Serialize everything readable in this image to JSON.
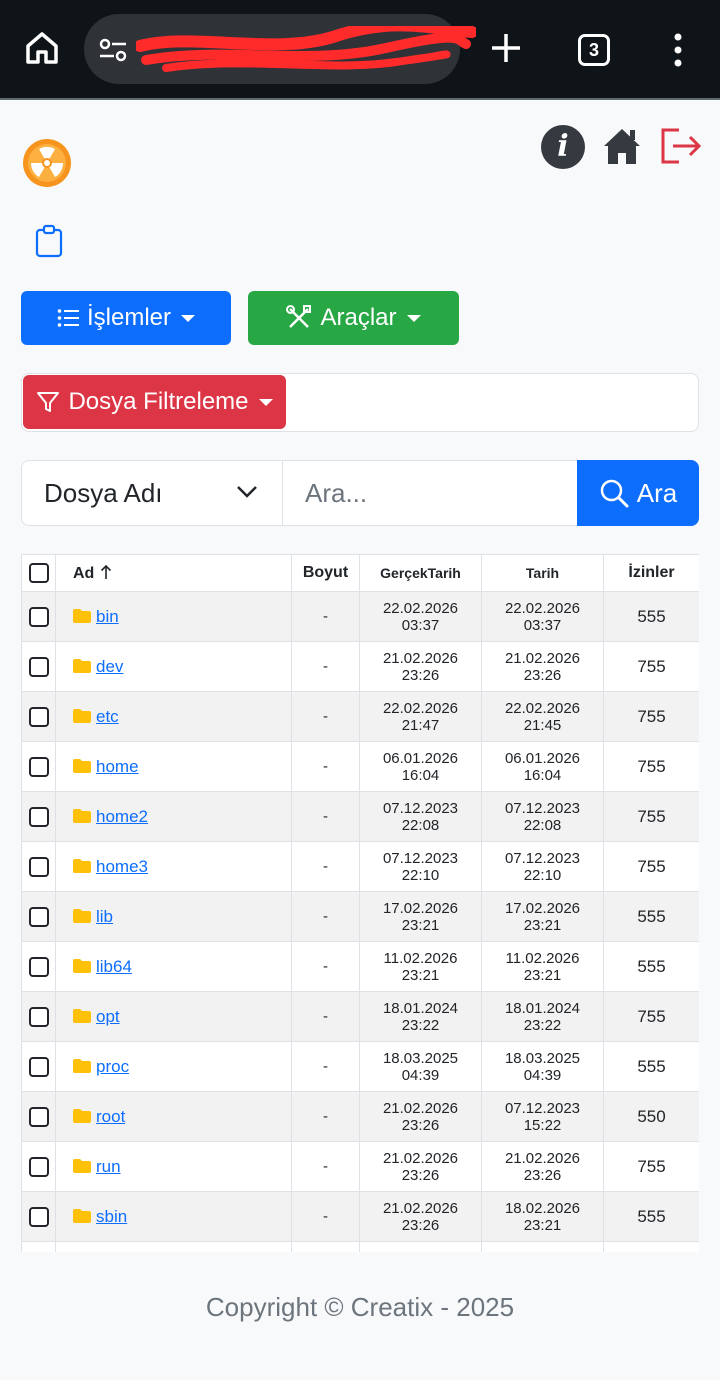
{
  "browser": {
    "tab_count": "3",
    "colors": {
      "bar": "#0f1419",
      "pill": "#2f3338",
      "redaction": "#ff2a2a"
    }
  },
  "header": {
    "info_label": "i",
    "colors": {
      "logo": "#f7941d",
      "logout": "#dc3545"
    }
  },
  "toolbar": {
    "operations_label": "İşlemler",
    "tools_label": "Araçlar",
    "filter_label": "Dosya Filtreleme",
    "colors": {
      "primary": "#0d6efd",
      "success": "#28a745",
      "danger": "#dc3545"
    }
  },
  "search": {
    "select_value": "Dosya Adı",
    "placeholder": "Ara...",
    "button_label": "Ara"
  },
  "table": {
    "headers": {
      "name": "Ad",
      "size": "Boyut",
      "real_date": "GerçekTarih",
      "date": "Tarih",
      "permissions": "İzinler"
    },
    "rows": [
      {
        "name": "bin",
        "size": "-",
        "real_date": "22.02.2026",
        "real_time": "03:37",
        "date": "22.02.2026",
        "time": "03:37",
        "perm": "555"
      },
      {
        "name": "dev",
        "size": "-",
        "real_date": "21.02.2026",
        "real_time": "23:26",
        "date": "21.02.2026",
        "time": "23:26",
        "perm": "755"
      },
      {
        "name": "etc",
        "size": "-",
        "real_date": "22.02.2026",
        "real_time": "21:47",
        "date": "22.02.2026",
        "time": "21:45",
        "perm": "755"
      },
      {
        "name": "home",
        "size": "-",
        "real_date": "06.01.2026",
        "real_time": "16:04",
        "date": "06.01.2026",
        "time": "16:04",
        "perm": "755"
      },
      {
        "name": "home2",
        "size": "-",
        "real_date": "07.12.2023",
        "real_time": "22:08",
        "date": "07.12.2023",
        "time": "22:08",
        "perm": "755"
      },
      {
        "name": "home3",
        "size": "-",
        "real_date": "07.12.2023",
        "real_time": "22:10",
        "date": "07.12.2023",
        "time": "22:10",
        "perm": "755"
      },
      {
        "name": "lib",
        "size": "-",
        "real_date": "17.02.2026",
        "real_time": "23:21",
        "date": "17.02.2026",
        "time": "23:21",
        "perm": "555"
      },
      {
        "name": "lib64",
        "size": "-",
        "real_date": "11.02.2026",
        "real_time": "23:21",
        "date": "11.02.2026",
        "time": "23:21",
        "perm": "555"
      },
      {
        "name": "opt",
        "size": "-",
        "real_date": "18.01.2024",
        "real_time": "23:22",
        "date": "18.01.2024",
        "time": "23:22",
        "perm": "755"
      },
      {
        "name": "proc",
        "size": "-",
        "real_date": "18.03.2025",
        "real_time": "04:39",
        "date": "18.03.2025",
        "time": "04:39",
        "perm": "555"
      },
      {
        "name": "root",
        "size": "-",
        "real_date": "21.02.2026",
        "real_time": "23:26",
        "date": "07.12.2023",
        "time": "15:22",
        "perm": "550"
      },
      {
        "name": "run",
        "size": "-",
        "real_date": "21.02.2026",
        "real_time": "23:26",
        "date": "21.02.2026",
        "time": "23:26",
        "perm": "755"
      },
      {
        "name": "sbin",
        "size": "-",
        "real_date": "21.02.2026",
        "real_time": "23:26",
        "date": "18.02.2026",
        "time": "23:21",
        "perm": "555"
      },
      {
        "name": "",
        "size": "",
        "real_date": "",
        "real_time": "",
        "date": "",
        "time": "",
        "perm": ""
      }
    ],
    "colors": {
      "stripe": "#f2f2f2",
      "link": "#0d6efd",
      "folder": "#ffc107"
    }
  },
  "footer": {
    "text": "Copyright © Creatix - 2025"
  }
}
